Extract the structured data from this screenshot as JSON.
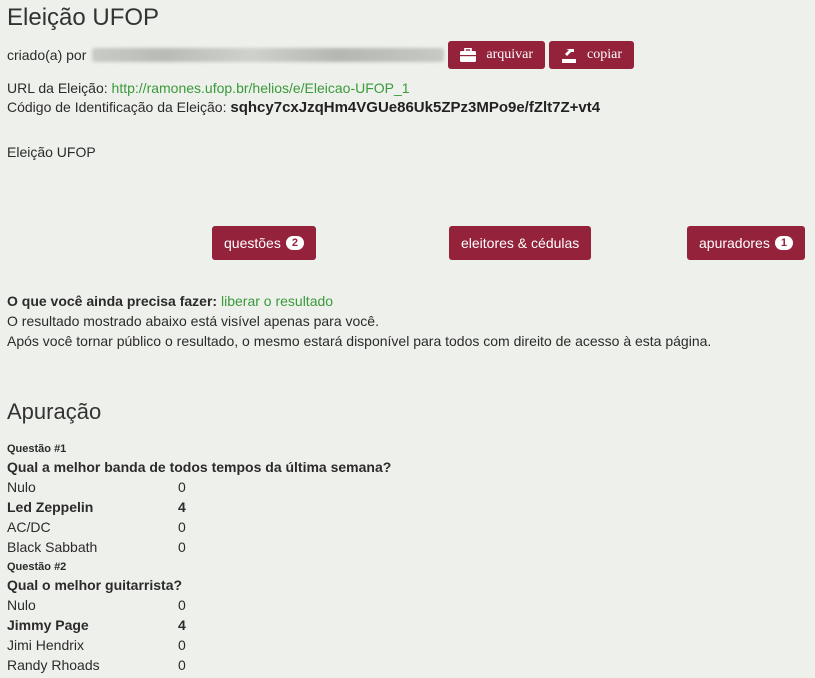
{
  "page": {
    "title": "Eleição UFOP",
    "created_by_label": "criado(a) por",
    "archive_label": "arquivar",
    "copy_label": "copiar",
    "url_label": "URL da Eleição:",
    "url_value": "http://ramones.ufop.br/helios/e/Eleicao-UFOP_1",
    "code_label": "Código de Identificação da Eleição:",
    "code_value": "sqhcy7cxJzqHm4VGUe86Uk5ZPz3MPo9e/fZlt7Z+vt4",
    "description": "Eleição UFOP"
  },
  "actions": {
    "questions_label": "questões",
    "questions_count": "2",
    "voters_label": "eleitores & cédulas",
    "trustees_label": "apuradores",
    "trustees_count": "1"
  },
  "todo": {
    "prompt": "O que você ainda precisa fazer:",
    "action_link": "liberar o resultado",
    "line1": "O resultado mostrado abaixo está visível apenas para você.",
    "line2": "Após você tornar público o resultado, o mesmo estará disponível para todos com direito de acesso à esta página."
  },
  "tally": {
    "heading": "Apuração",
    "questions": [
      {
        "number": "Questão #1",
        "text": "Qual a melhor banda de todos tempos da última semana?",
        "answers": [
          {
            "name": "Nulo",
            "votes": "0"
          },
          {
            "name": "Led Zeppelin",
            "votes": "4"
          },
          {
            "name": "AC/DC",
            "votes": "0"
          },
          {
            "name": "Black Sabbath",
            "votes": "0"
          }
        ]
      },
      {
        "number": "Questão #2",
        "text": "Qual o melhor guitarrista?",
        "answers": [
          {
            "name": "Nulo",
            "votes": "0"
          },
          {
            "name": "Jimmy Page",
            "votes": "4"
          },
          {
            "name": "Jimi Hendrix",
            "votes": "0"
          },
          {
            "name": "Randy Rhoads",
            "votes": "0"
          }
        ]
      }
    ]
  },
  "colors": {
    "accent": "#93223a",
    "link": "#3a9a3a",
    "background": "#eef0eb"
  },
  "icons": {
    "archive": "briefcase-icon",
    "copy": "copy-icon"
  }
}
